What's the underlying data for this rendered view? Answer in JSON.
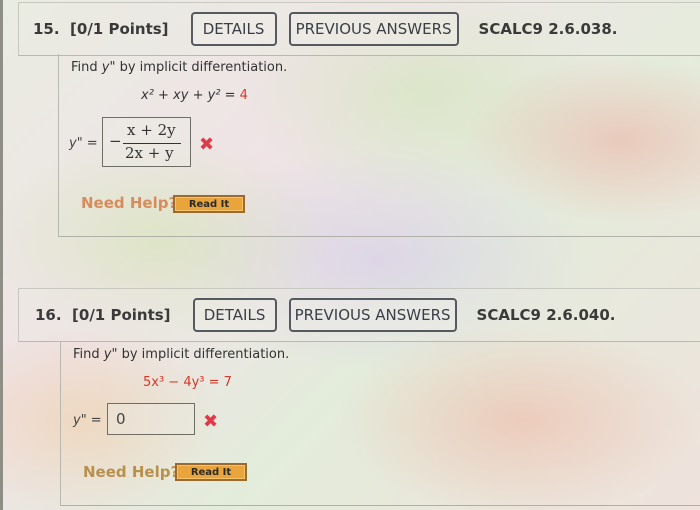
{
  "questions": [
    {
      "number_label": "15.",
      "points_label": "[0/1 Points]",
      "details_label": "DETAILS",
      "previous_answers_label": "PREVIOUS ANSWERS",
      "reference": "SCALC9 2.6.038.",
      "prompt_pre": "Find ",
      "prompt_var": "y\"",
      "prompt_post": " by implicit differentiation.",
      "equation_lhs": "x² + xy + y² = ",
      "equation_rhs": "4",
      "answer_label": "y\" =",
      "answer_sign": "−",
      "answer_numerator": "x + 2y",
      "answer_denominator": "2x + y",
      "status_icon": "incorrect-x-icon",
      "status_glyph": "✖",
      "need_help_label": "Need Help?",
      "read_it_label": "Read It"
    },
    {
      "number_label": "16.",
      "points_label": "[0/1 Points]",
      "details_label": "DETAILS",
      "previous_answers_label": "PREVIOUS ANSWERS",
      "reference": "SCALC9 2.6.040.",
      "prompt_pre": "Find ",
      "prompt_var": "y\"",
      "prompt_post": " by implicit differentiation.",
      "equation_lhs": "5x³ − 4y³ = ",
      "equation_rhs": "7",
      "answer_label": "y\" =",
      "answer_value": "0",
      "status_icon": "incorrect-x-icon",
      "status_glyph": "✖",
      "need_help_label": "Need Help?",
      "read_it_label": "Read It"
    }
  ]
}
